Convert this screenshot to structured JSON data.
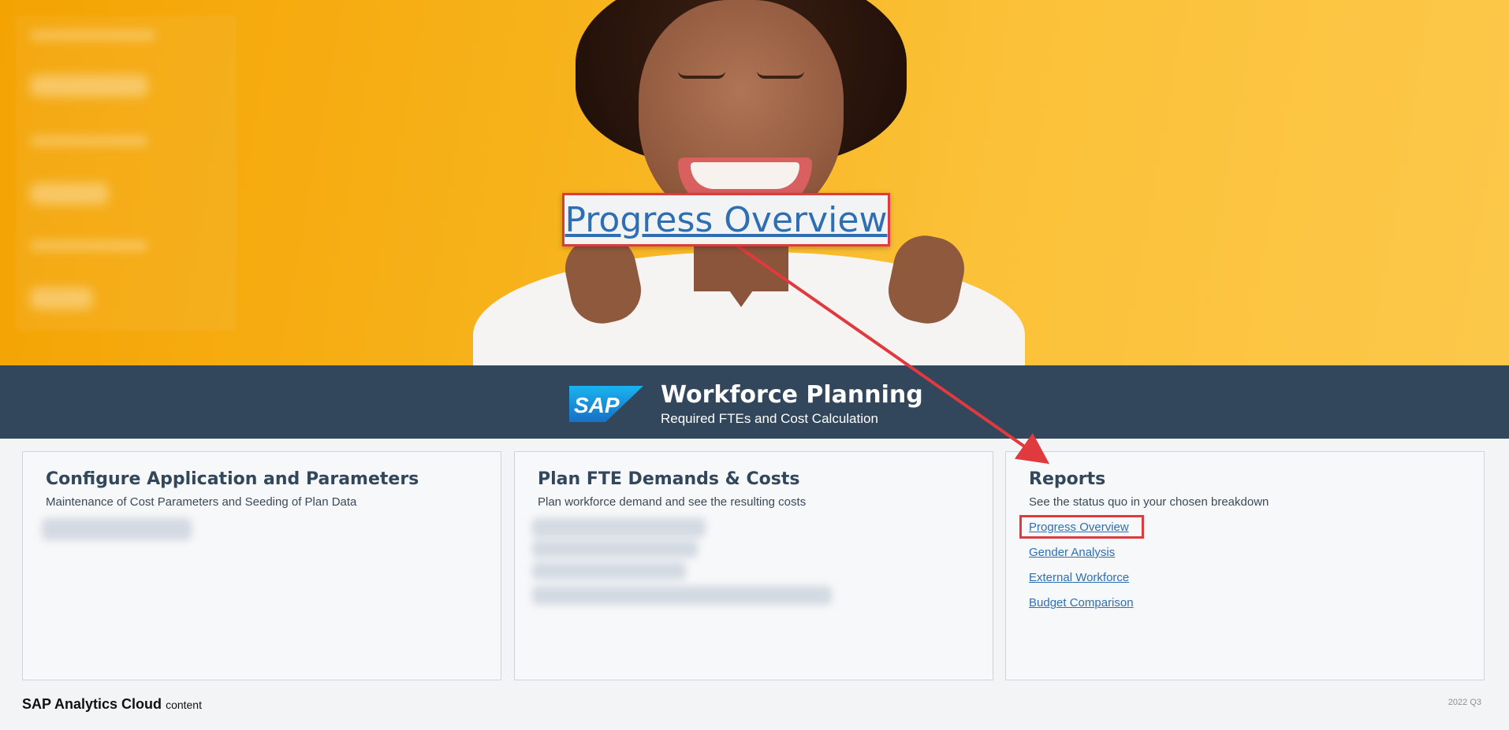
{
  "callout": {
    "label": "Progress Overview"
  },
  "banner": {
    "logo_text": "SAP",
    "title": "Workforce Planning",
    "subtitle": "Required FTEs and Cost Calculation"
  },
  "cards": [
    {
      "title": "Configure Application and Parameters",
      "description": "Maintenance of Cost Parameters and Seeding of Plan Data"
    },
    {
      "title": "Plan FTE Demands & Costs",
      "description": "Plan workforce demand and see the resulting costs"
    },
    {
      "title": "Reports",
      "description": "See the status quo in your chosen breakdown",
      "links": [
        "Progress Overview",
        "Gender Analysis",
        "External Workforce",
        "Budget Comparison"
      ]
    }
  ],
  "footer": {
    "brand": "SAP Analytics Cloud",
    "brand_suffix": "content",
    "version": "2022 Q3"
  },
  "colors": {
    "banner": "#32475c",
    "link": "#2e6fb4",
    "highlight": "#e0393e",
    "hero": "#f7b21a"
  }
}
